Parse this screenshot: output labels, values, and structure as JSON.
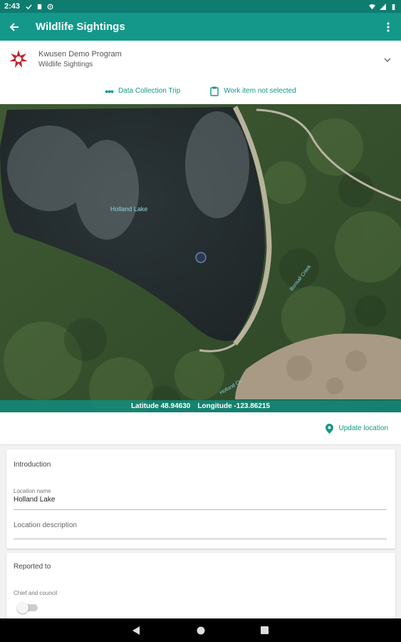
{
  "status_bar": {
    "time": "2:43"
  },
  "app_bar": {
    "title": "Wildlife Sightings"
  },
  "program": {
    "name": "Kwusen Demo Program",
    "subtitle": "Wildlife Sightings"
  },
  "actions": {
    "trip_label": "Data Collection Trip",
    "work_item_label": "Work item not selected"
  },
  "map": {
    "lake_label": "Holland Lake",
    "creek_label": "Bonsall Creek",
    "road_label": "Holland Ck",
    "coordinates": {
      "latitude_text": "Latitude 48.94630",
      "longitude_text": "Longitude -123.86215"
    }
  },
  "update_location": {
    "label": "Update location"
  },
  "introduction": {
    "title": "Introduction",
    "location_name_label": "Location name",
    "location_name_value": "Holland Lake",
    "location_description_placeholder": "Location description"
  },
  "reported_to": {
    "title": "Reported to",
    "chief_label": "Chief and council",
    "chief_toggle_on": false
  },
  "colors": {
    "primary": "#13988a",
    "primary_dark": "#0d7d70",
    "accent_text": "#13988a"
  }
}
